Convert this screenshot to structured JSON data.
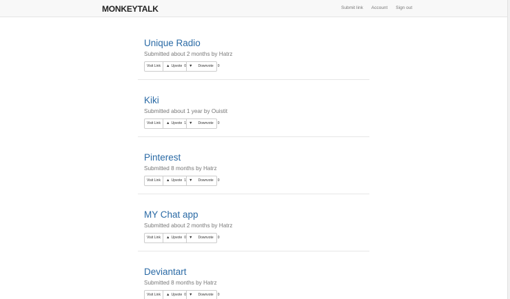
{
  "navbar": {
    "brand": "MONKEYTALK",
    "links": [
      "Submit link",
      "Account",
      "Sign out"
    ]
  },
  "buttons": {
    "visit_label": "Visit Link",
    "upvote_label": "Upvote",
    "downvote_label": "Downvote",
    "up_icon": "chevron-up-icon",
    "down_icon": "chevron-down-icon"
  },
  "links": [
    {
      "title": "Unique Radio",
      "meta": "Submitted about 2 months by Hatrz",
      "upvotes": "0",
      "downvotes": "0"
    },
    {
      "title": "Kiki",
      "meta": "Submitted about 1 year by Ouistit",
      "upvotes": "1",
      "downvotes": "0"
    },
    {
      "title": "Pinterest",
      "meta": "Submitted 8 months by Hatrz",
      "upvotes": "1",
      "downvotes": "0"
    },
    {
      "title": "MY Chat app",
      "meta": "Submitted about 2 months by Hatrz",
      "upvotes": "0",
      "downvotes": "0"
    },
    {
      "title": "Deviantart",
      "meta": "Submitted 8 months by Hatrz",
      "upvotes": "0",
      "downvotes": "0"
    }
  ],
  "colors": {
    "link": "#2a6aa5",
    "meta": "#777777",
    "navbar_bg": "#f8f8f8"
  }
}
